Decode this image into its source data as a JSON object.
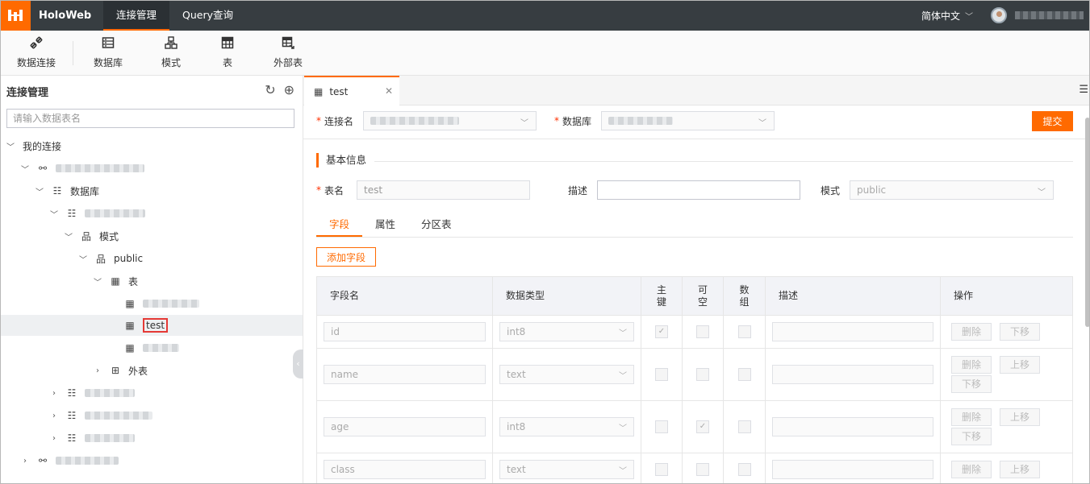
{
  "topbar": {
    "brand": "HoloWeb",
    "nav": [
      {
        "label": "连接管理",
        "active": true
      },
      {
        "label": "Query查询",
        "active": false
      }
    ],
    "language": "简体中文",
    "accent": "#ff6a00"
  },
  "toolbar": {
    "items": [
      {
        "label": "数据连接",
        "icon": "link-icon"
      },
      {
        "label": "数据库",
        "icon": "database-icon"
      },
      {
        "label": "模式",
        "icon": "schema-icon"
      },
      {
        "label": "表",
        "icon": "table-icon"
      },
      {
        "label": "外部表",
        "icon": "foreign-table-icon"
      }
    ]
  },
  "sidebar": {
    "title": "连接管理",
    "search_placeholder": "请输入数据表名",
    "tree": {
      "my_connections": "我的连接",
      "database": "数据库",
      "schema": "模式",
      "public": "public",
      "tables": "表",
      "selected_table": "test",
      "foreign_tables": "外表"
    }
  },
  "main": {
    "tab_label": "test",
    "connection_label": "连接名",
    "database_label": "数据库",
    "submit_label": "提交",
    "section_title": "基本信息",
    "table_name_label": "表名",
    "table_name_value": "test",
    "description_label": "描述",
    "schema_label": "模式",
    "schema_value": "public",
    "subtabs": [
      "字段",
      "属性",
      "分区表"
    ],
    "add_field_label": "添加字段",
    "columns": {
      "name": "字段名",
      "type": "数据类型",
      "pk": [
        "主",
        "键"
      ],
      "nullable": [
        "可",
        "空"
      ],
      "array": [
        "数",
        "组"
      ],
      "desc": "描述",
      "ops": "操作"
    },
    "delete_label": "删除",
    "up_label": "上移",
    "down_label": "下移",
    "rows": [
      {
        "name": "id",
        "type": "int8",
        "pk": true,
        "nullable": false
      },
      {
        "name": "name",
        "type": "text",
        "pk": false,
        "nullable": false
      },
      {
        "name": "age",
        "type": "int8",
        "pk": false,
        "nullable": true
      },
      {
        "name": "class",
        "type": "text",
        "pk": false,
        "nullable": false
      }
    ]
  }
}
